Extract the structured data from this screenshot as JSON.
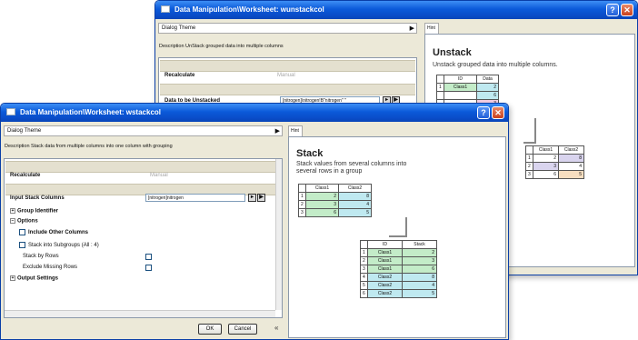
{
  "back_window": {
    "title": "Data Manipulation\\Worksheet: wunstackcol",
    "theme_label": "Dialog Theme",
    "hint_tab": "Hint",
    "description": "Description   UnStack grouped data into multiple columns",
    "recalculate_label": "Recalculate",
    "recalculate_value": "Manual",
    "data_label": "Data to be Unstacked",
    "data_value": "[nitrogen]\\nitrogen!B\"nitrogen\" \"",
    "hint": {
      "title": "Unstack",
      "desc": "Unstack grouped data into multiple columns.",
      "table1": {
        "headers": [
          "ID",
          "Data"
        ],
        "rows": [
          [
            "1",
            "Class1",
            "2"
          ],
          [
            "",
            "",
            "6"
          ],
          [
            "",
            "",
            "3"
          ],
          [
            "",
            "",
            "4"
          ],
          [
            "",
            "",
            "6"
          ],
          [
            "",
            "",
            "5"
          ]
        ]
      },
      "table2": {
        "headers": [
          "Class1",
          "Class2"
        ],
        "rows": [
          [
            "1",
            "2",
            "8"
          ],
          [
            "2",
            "3",
            "4"
          ],
          [
            "3",
            "6",
            "5"
          ]
        ]
      }
    }
  },
  "front_window": {
    "title": "Data Manipulation\\Worksheet: wstackcol",
    "theme_label": "Dialog Theme",
    "hint_tab": "Hint",
    "description": "Description   Stack data from multiple columns into one column with grouping",
    "recalculate_label": "Recalculate",
    "recalculate_value": "Manual",
    "input_label": "Input Stack Columns",
    "input_value": "[nitrogen]nitrogen",
    "group_identifier": "Group Identifier",
    "options": "Options",
    "include_other": "Include Other Columns",
    "stack_subgroups": "Stack into Subgroups (All : 4)",
    "stack_by_rows": "Stack by Rows",
    "exclude_missing": "Exclude Missing Rows",
    "output_settings": "Output Settings",
    "ok": "OK",
    "cancel": "Cancel",
    "collapse": "«",
    "hint": {
      "title": "Stack",
      "desc": "Stack values from several columns into several rows in a group",
      "table1": {
        "headers": [
          "Class1",
          "Class2"
        ],
        "rows": [
          [
            "1",
            "2",
            "8"
          ],
          [
            "2",
            "3",
            "4"
          ],
          [
            "3",
            "6",
            "5"
          ]
        ]
      },
      "table2": {
        "headers": [
          "ID",
          "Stack"
        ],
        "rows": [
          [
            "1",
            "Class1",
            "2"
          ],
          [
            "2",
            "Class1",
            "3"
          ],
          [
            "3",
            "Class1",
            "6"
          ],
          [
            "4",
            "Class2",
            "8"
          ],
          [
            "5",
            "Class2",
            "4"
          ],
          [
            "6",
            "Class2",
            "5"
          ]
        ]
      }
    }
  }
}
